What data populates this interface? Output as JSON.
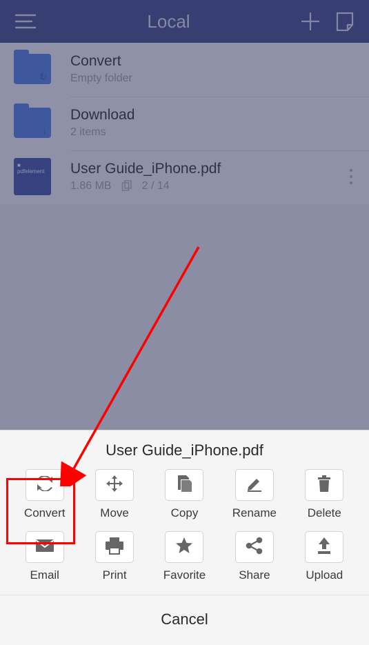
{
  "header": {
    "title": "Local"
  },
  "files": [
    {
      "name": "Convert",
      "subtitle": "Empty folder",
      "kind": "folder",
      "glyph": "sync"
    },
    {
      "name": "Download",
      "subtitle": "2 items",
      "kind": "folder",
      "glyph": "download"
    },
    {
      "name": "User Guide_iPhone.pdf",
      "size": "1.86 MB",
      "pages": "2 / 14",
      "kind": "pdf"
    }
  ],
  "sheet": {
    "filename": "User Guide_iPhone.pdf",
    "actions": [
      {
        "id": "convert",
        "label": "Convert"
      },
      {
        "id": "move",
        "label": "Move"
      },
      {
        "id": "copy",
        "label": "Copy"
      },
      {
        "id": "rename",
        "label": "Rename"
      },
      {
        "id": "delete",
        "label": "Delete"
      },
      {
        "id": "email",
        "label": "Email"
      },
      {
        "id": "print",
        "label": "Print"
      },
      {
        "id": "favorite",
        "label": "Favorite"
      },
      {
        "id": "share",
        "label": "Share"
      },
      {
        "id": "upload",
        "label": "Upload"
      }
    ],
    "cancel": "Cancel"
  }
}
